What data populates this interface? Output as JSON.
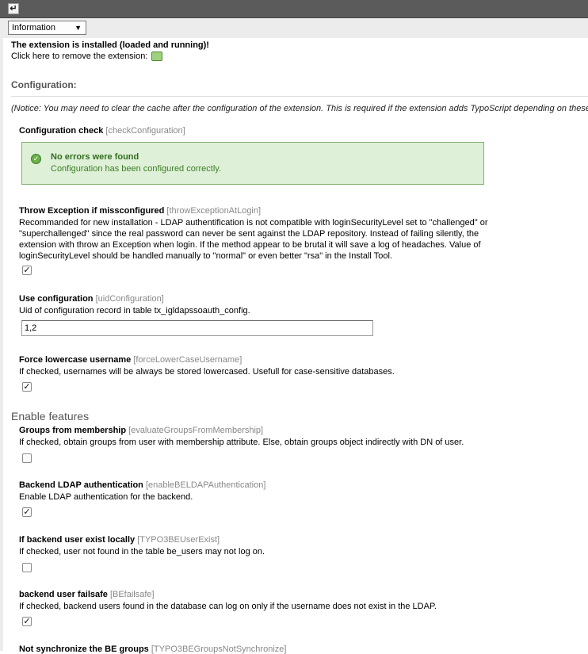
{
  "topbar": {
    "back_label": "↵"
  },
  "menu": {
    "selected": "Information",
    "arrow": "▼"
  },
  "status": {
    "installed_text": "The extension is installed (loaded and running)!",
    "remove_text": "Click here to remove the extension:"
  },
  "configuration": {
    "heading": "Configuration:",
    "notice": "(Notice: You may need to clear the cache after the configuration of the extension. This is required if the extension adds TypoScript depending on these"
  },
  "fields": {
    "check": {
      "label": "Configuration check",
      "key": "[checkConfiguration]",
      "ok_title": "No errors were found",
      "ok_text": "Configuration has been configured correctly."
    },
    "throw": {
      "label": "Throw Exception if missconfigured",
      "key": "[throwExceptionAtLogin]",
      "desc": "Recommanded for new installation - LDAP authentification is not compatible with loginSecurityLevel set to \"challenged\" or \"superchallenged\" since the real password can never be sent against the LDAP repository. Instead of failing silently, the extension with throw an Exception when login. If the method appear to be brutal it will save a log of headaches. Value of loginSecurityLevel should be handled manually to \"normal\" or even better \"rsa\" in the Install Tool.",
      "checked": "✓"
    },
    "uid": {
      "label": "Use configuration",
      "key": "[uidConfiguration]",
      "desc": "Uid of configuration record in table tx_igldapssoauth_config.",
      "value": "1,2"
    },
    "lower": {
      "label": "Force lowercase username",
      "key": "[forceLowerCaseUsername]",
      "desc": "If checked, usernames will be always be stored lowercased. Usefull for case-sensitive databases.",
      "checked": "✓"
    }
  },
  "features": {
    "heading": "Enable features",
    "groups": {
      "label": "Groups from membership",
      "key": "[evaluateGroupsFromMembership]",
      "desc": "If checked, obtain groups from user with membership attribute. Else, obtain groups object indirectly with DN of user.",
      "checked": ""
    },
    "beldap": {
      "label": "Backend LDAP authentication",
      "key": "[enableBELDAPAuthentication]",
      "desc": "Enable LDAP authentication for the backend.",
      "checked": "✓"
    },
    "beexist": {
      "label": "If backend user exist locally",
      "key": "[TYPO3BEUserExist]",
      "desc": "If checked, user not found in the table be_users may not log on.",
      "checked": ""
    },
    "failsafe": {
      "label": "backend user failsafe",
      "key": "[BEfailsafe]",
      "desc": "If checked, backend users found in the database can log on only if the username does not exist in the LDAP.",
      "checked": "✓"
    },
    "nosync": {
      "label": "Not synchronize the BE groups",
      "key": "[TYPO3BEGroupsNotSynchronize]"
    }
  }
}
